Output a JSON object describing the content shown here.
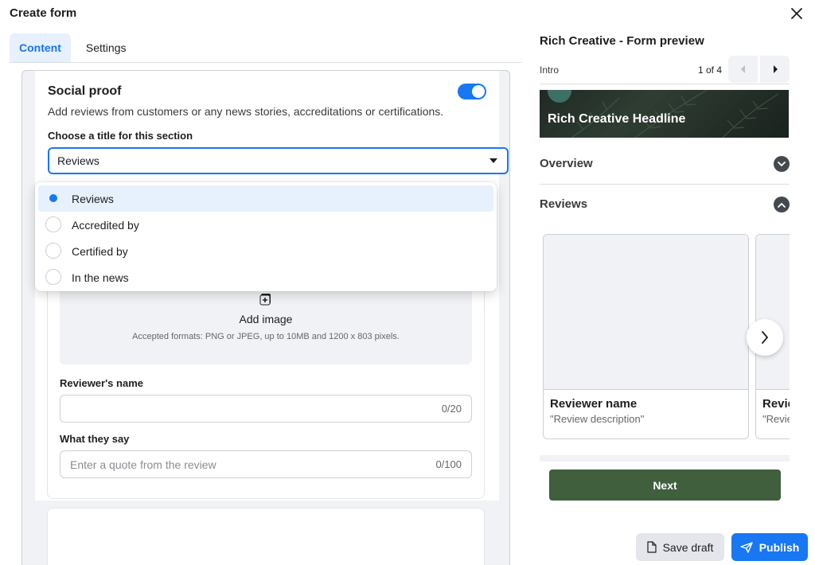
{
  "header": {
    "title": "Create form"
  },
  "tabs": [
    {
      "label": "Content"
    },
    {
      "label": "Settings"
    }
  ],
  "social_proof": {
    "title": "Social proof",
    "description": "Add reviews from customers or any news stories, accreditations or certifications.",
    "toggle_on": true,
    "title_label": "Choose a title for this section",
    "selected_title": "Reviews",
    "options": [
      {
        "label": "Reviews",
        "selected": true
      },
      {
        "label": "Accredited by",
        "selected": false
      },
      {
        "label": "Certified by",
        "selected": false
      },
      {
        "label": "In the news",
        "selected": false
      }
    ]
  },
  "review_form": {
    "add_image_label": "Add image",
    "image_hint": "Accepted formats: PNG or JPEG, up to 10MB and 1200 x 803 pixels.",
    "reviewer_name_label": "Reviewer's name",
    "reviewer_name_value": "",
    "reviewer_name_counter": "0/20",
    "what_they_say_label": "What they say",
    "what_they_say_placeholder": "Enter a quote from the review",
    "what_they_say_counter": "0/100"
  },
  "preview": {
    "title": "Rich Creative - Form preview",
    "nav_label": "Intro",
    "page_indicator": "1 of 4",
    "headline": "Rich Creative Headline",
    "sections": [
      {
        "label": "Overview",
        "expanded": false
      },
      {
        "label": "Reviews",
        "expanded": true
      }
    ],
    "review_cards": [
      {
        "name": "Reviewer name",
        "description": "\"Review description\""
      },
      {
        "name": "Reviewer name",
        "description": "\"Review description\""
      }
    ],
    "next_label": "Next"
  },
  "footer": {
    "save_draft_label": "Save draft",
    "publish_label": "Publish"
  },
  "colors": {
    "accent": "#1877f2",
    "next_button": "#3f5f3d",
    "selected_option_bg": "#e7f0fd"
  },
  "icons": {
    "close": "close-icon",
    "dropdown": "caret-down-icon",
    "image": "add-image-icon",
    "prev": "caret-left-icon",
    "next": "caret-right-icon",
    "chevron_down": "chevron-down-icon",
    "chevron_up": "chevron-up-icon",
    "carousel_next": "chevron-right-icon",
    "save": "document-icon",
    "publish": "paper-plane-icon"
  }
}
